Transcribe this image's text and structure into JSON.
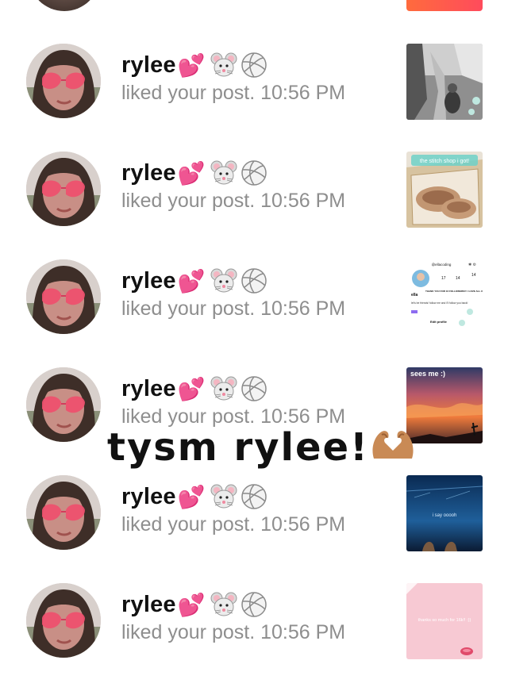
{
  "notifications": [
    {
      "username": "rylee",
      "emojis": [
        "💕",
        "🐭",
        "🏐"
      ],
      "activity": "liked your post.",
      "time": "10:56 PM",
      "thumb": "bw-photo"
    },
    {
      "username": "rylee",
      "emojis": [
        "💕",
        "🐭",
        "🏐"
      ],
      "activity": "liked your post.",
      "time": "10:56 PM",
      "thumb": "shoe-box",
      "thumb_text": "the stitch shop i got!"
    },
    {
      "username": "rylee",
      "emojis": [
        "💕",
        "🐭",
        "🏐"
      ],
      "activity": "liked your post.",
      "time": "10:56 PM",
      "thumb": "profile-screenshot",
      "thumb_profile": {
        "handle": "@ellacoding",
        "stat1": "17",
        "stat2": "14",
        "stat3": "14",
        "name": "ella",
        "banner": "THANK YOU FOR 16 FOLLOWERS!!! I LOVE ALL OF YOU",
        "bio": "let's be friends! follow me and i'll follow you back!",
        "edit": "Edit profile"
      }
    },
    {
      "username": "rylee",
      "emojis": [
        "💕",
        "🐭",
        "🏐"
      ],
      "activity": "liked your post.",
      "time": "10:56 PM",
      "thumb": "sunset",
      "thumb_text": "sees me :)"
    },
    {
      "username": "rylee",
      "emojis": [
        "💕",
        "🐭",
        "🏐"
      ],
      "activity": "liked your post.",
      "time": "10:56 PM",
      "thumb": "ocean",
      "thumb_text": "i say ooooh"
    },
    {
      "username": "rylee",
      "emojis": [
        "💕",
        "🐭",
        "🏐"
      ],
      "activity": "liked your post.",
      "time": "10:56 PM",
      "thumb": "pink",
      "thumb_text": "thanks so much for 16k!! :))"
    }
  ],
  "overlay_text": "tysm rylee!",
  "colors": {
    "heart": "#ff3fa4",
    "secondary_text": "#8e8e8e",
    "primary_text": "#111111"
  }
}
